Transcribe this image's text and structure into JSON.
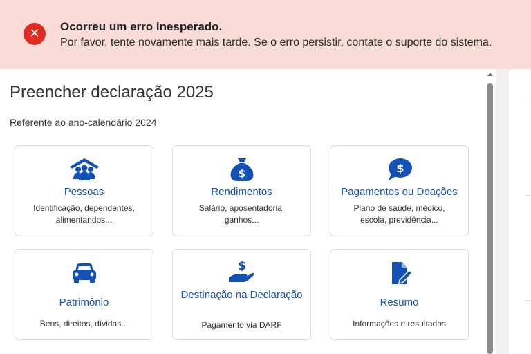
{
  "error": {
    "icon": "close-icon",
    "title": "Ocorreu um erro inesperado.",
    "message": "Por favor, tente novamente mais tarde. Se o erro persistir, contate o suporte do sistema."
  },
  "page": {
    "title": "Preencher declaração 2025",
    "subtitle": "Referente ao ano-calendário 2024"
  },
  "cards": [
    {
      "icon": "people-house-icon",
      "title": "Pessoas",
      "description": "Identificação, dependentes, alimentandos..."
    },
    {
      "icon": "money-bag-icon",
      "title": "Rendimentos",
      "description": "Salário, aposentadoria, ganhos..."
    },
    {
      "icon": "dollar-speech-bubble-icon",
      "title": "Pagamentos ou Doações",
      "description": "Plano de saúde, médico, escola, previdência..."
    },
    {
      "icon": "car-icon",
      "title": "Patrimônio",
      "description": "Bens, direitos, dívidas..."
    },
    {
      "icon": "hand-dollar-icon",
      "title": "Destinação na Declaração",
      "description": "Pagamento via DARF"
    },
    {
      "icon": "document-edit-icon",
      "title": "Resumo",
      "description": "Informações e resultados"
    }
  ],
  "colors": {
    "accent": "#1351b4",
    "error_background": "#f9dcd8",
    "error_icon": "#e02b22"
  }
}
